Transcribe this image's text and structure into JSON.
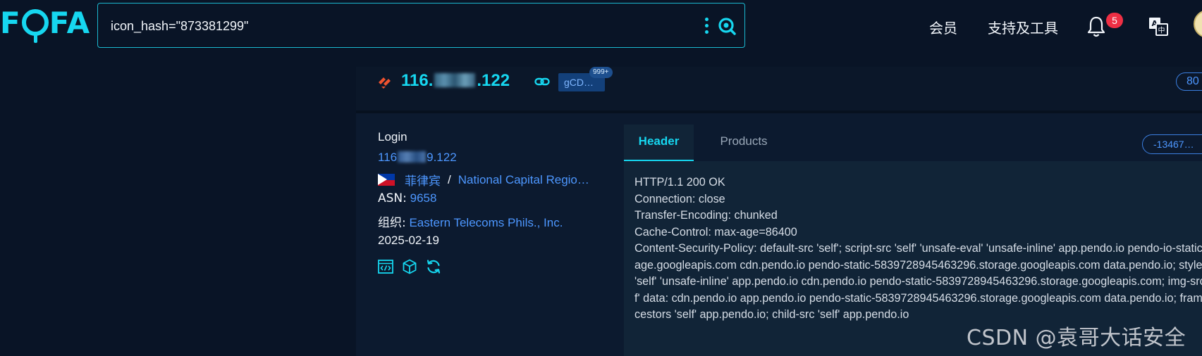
{
  "app": {
    "logo_text": "FOFA",
    "brand_color": "#16d7f0",
    "background": "#091426"
  },
  "search": {
    "value": "icon_hash=\"873381299\"",
    "more_icon": "kebab-vertical-icon",
    "search_icon": "search-icon"
  },
  "nav": {
    "member": "会员",
    "support_tools": "支持及工具",
    "notifications_count": "5",
    "bell_icon": "bell-icon",
    "translate_icon": "translate-icon"
  },
  "result": {
    "ip_prefix": "116.",
    "ip_suffix": ".122",
    "domain_tag": "gCD…",
    "domain_count": "999+",
    "port": "80",
    "title": "Login",
    "ip_link_prefix": "116",
    "ip_link_suffix": "9.122",
    "country": "菲律宾",
    "location_separator": "/",
    "region": "National Capital Regio…",
    "asn_label": "ASN:",
    "asn_value": "9658",
    "org_label": "组织:",
    "org_value": "Eastern Telecoms Phils., Inc.",
    "date": "2025-02-19",
    "tabs": {
      "header": "Header",
      "products": "Products"
    },
    "icon_hash_pill": "-13467…",
    "header_text": "HTTP/1.1 200 OK\nConnection: close\nTransfer-Encoding: chunked\nCache-Control: max-age=86400\nContent-Security-Policy: default-src 'self'; script-src 'self' 'unsafe-eval' 'unsafe-inline' app.pendo.io pendo-io-static.storage.googleapis.com cdn.pendo.io pendo-static-5839728945463296.storage.googleapis.com data.pendo.io; style-src 'self' 'unsafe-inline' app.pendo.io cdn.pendo.io pendo-static-5839728945463296.storage.googleapis.com; img-src 'self' data: cdn.pendo.io app.pendo.io pendo-static-5839728945463296.storage.googleapis.com data.pendo.io; frame-ancestors 'self' app.pendo.io; child-src 'self' app.pendo.io"
  },
  "watermark": "CSDN @袁哥大话安全"
}
